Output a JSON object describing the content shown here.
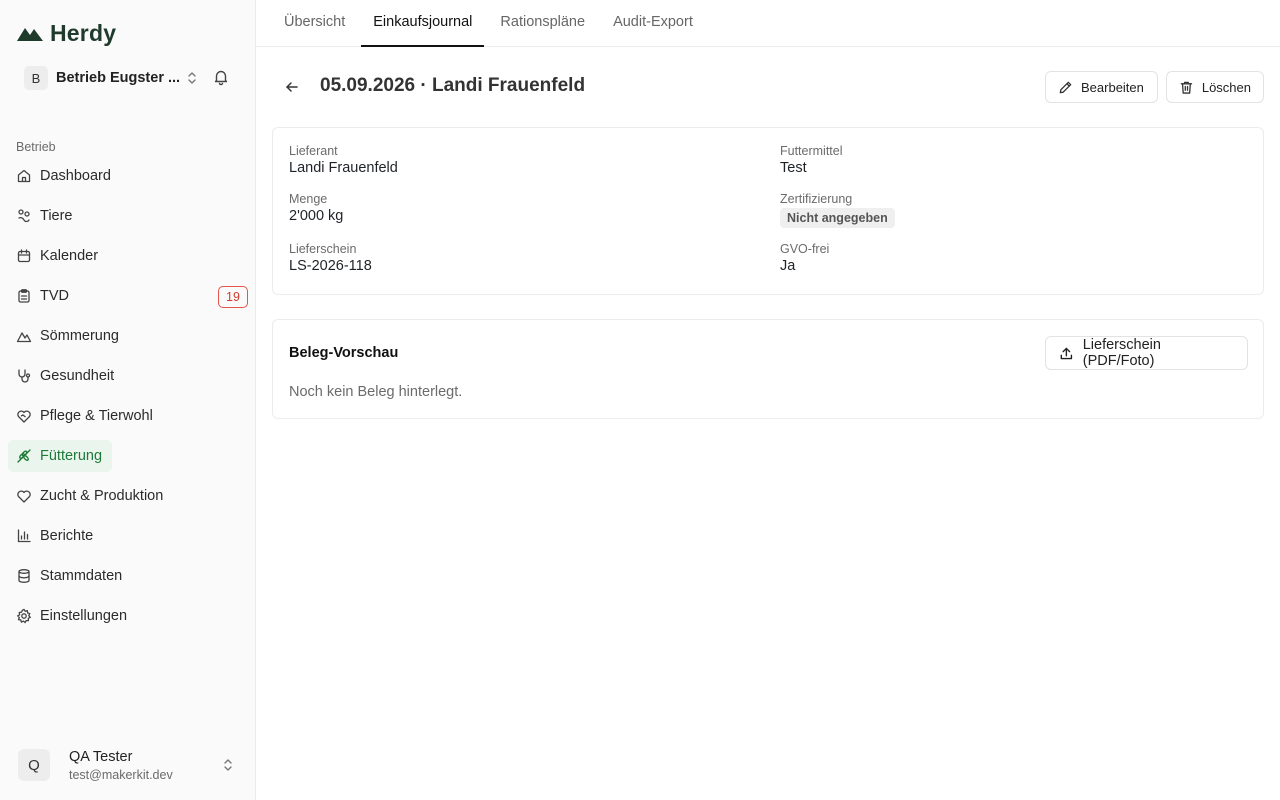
{
  "app": {
    "name": "Herdy"
  },
  "org": {
    "initial": "B",
    "name": "Betrieb Eugster ..."
  },
  "sidebar": {
    "section_label": "Betrieb",
    "items": [
      {
        "label": "Dashboard",
        "icon": "home-icon"
      },
      {
        "label": "Tiere",
        "icon": "animal-icon"
      },
      {
        "label": "Kalender",
        "icon": "calendar-icon"
      },
      {
        "label": "TVD",
        "icon": "clipboard-icon",
        "badge": "19"
      },
      {
        "label": "Sömmerung",
        "icon": "mountain-icon"
      },
      {
        "label": "Gesundheit",
        "icon": "stethoscope-icon"
      },
      {
        "label": "Pflege & Tierwohl",
        "icon": "heart-handshake-icon"
      },
      {
        "label": "Fütterung",
        "icon": "wheat-icon",
        "active": true
      },
      {
        "label": "Zucht & Produktion",
        "icon": "heart-icon"
      },
      {
        "label": "Berichte",
        "icon": "bar-chart-icon"
      },
      {
        "label": "Stammdaten",
        "icon": "database-icon"
      },
      {
        "label": "Einstellungen",
        "icon": "gear-icon"
      }
    ]
  },
  "user": {
    "initial": "Q",
    "name": "QA Tester",
    "email": "test@makerkit.dev"
  },
  "tabs": [
    {
      "label": "Übersicht"
    },
    {
      "label": "Einkaufsjournal",
      "active": true
    },
    {
      "label": "Rationspläne"
    },
    {
      "label": "Audit-Export"
    }
  ],
  "page": {
    "title": "05.09.2026 · Landi Frauenfeld",
    "edit_label": "Bearbeiten",
    "delete_label": "Löschen"
  },
  "details": {
    "supplier_label": "Lieferant",
    "supplier_value": "Landi Frauenfeld",
    "feed_label": "Futtermittel",
    "feed_value": "Test",
    "quantity_label": "Menge",
    "quantity_value": "2'000 kg",
    "certification_label": "Zertifizierung",
    "certification_value": "Nicht angegeben",
    "delivery_note_label": "Lieferschein",
    "delivery_note_value": "LS-2026-118",
    "gmo_free_label": "GVO-frei",
    "gmo_free_value": "Ja"
  },
  "preview": {
    "title": "Beleg-Vorschau",
    "upload_label": "Lieferschein (PDF/Foto)",
    "empty_text": "Noch kein Beleg hinterlegt."
  },
  "colors": {
    "accent": "#1f7a3a",
    "active_bg": "#eaf5ed",
    "badge": "#d23b30",
    "logo": "#1e3b2c"
  }
}
